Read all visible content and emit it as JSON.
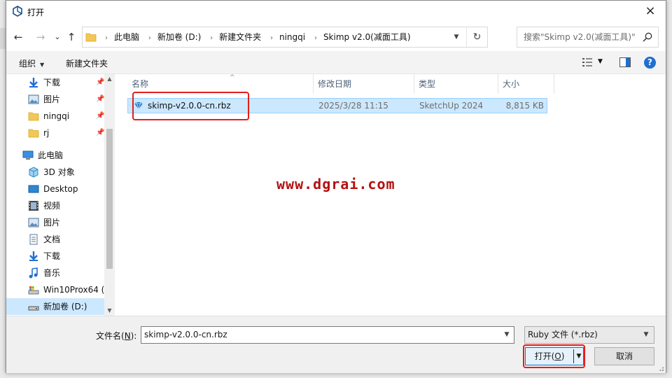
{
  "window": {
    "title": "打开",
    "close_icon": "×"
  },
  "nav": {
    "back_icon": "←",
    "forward_icon": "→",
    "recent_icon": "⌄",
    "up_icon": "↑",
    "breadcrumbs": [
      "此电脑",
      "新加卷 (D:)",
      "新建文件夹",
      "ningqi",
      "Skimp v2.0(减面工具)"
    ],
    "search_placeholder": "搜索\"Skimp v2.0(减面工具)\""
  },
  "toolbar": {
    "organize_label": "组织",
    "new_folder_label": "新建文件夹"
  },
  "sidebar": {
    "items": [
      {
        "label": "下载",
        "icon": "download-icon",
        "pinned": true
      },
      {
        "label": "图片",
        "icon": "pictures-icon",
        "pinned": true
      },
      {
        "label": "ningqi",
        "icon": "folder-icon",
        "pinned": true
      },
      {
        "label": "rj",
        "icon": "folder-icon",
        "pinned": true
      },
      {
        "label": "此电脑",
        "icon": "computer-icon",
        "pinned": false
      },
      {
        "label": "3D 对象",
        "icon": "3d-objects-icon",
        "pinned": false
      },
      {
        "label": "Desktop",
        "icon": "desktop-icon",
        "pinned": false
      },
      {
        "label": "视频",
        "icon": "videos-icon",
        "pinned": false
      },
      {
        "label": "图片",
        "icon": "pictures-icon",
        "pinned": false
      },
      {
        "label": "文档",
        "icon": "documents-icon",
        "pinned": false
      },
      {
        "label": "下载",
        "icon": "download-icon",
        "pinned": false
      },
      {
        "label": "音乐",
        "icon": "music-icon",
        "pinned": false
      },
      {
        "label": "Win10Prox64 (C",
        "icon": "system-drive-icon",
        "pinned": false
      },
      {
        "label": "新加卷 (D:)",
        "icon": "drive-icon",
        "pinned": false,
        "selected": true
      }
    ]
  },
  "files": {
    "columns": [
      "名称",
      "修改日期",
      "类型",
      "大小"
    ],
    "rows": [
      {
        "name": "skimp-v2.0.0-cn.rbz",
        "modified": "2025/3/28 11:15",
        "type": "SketchUp 2024",
        "size": "8,815 KB"
      }
    ]
  },
  "watermark": "www.dgrai.com",
  "footer": {
    "filename_label": "文件名(N):",
    "filename_label_main": "文件名(",
    "filename_label_key": "N",
    "filename_label_end": "):",
    "filename_value": "skimp-v2.0.0-cn.rbz",
    "filetype_value": "Ruby 文件 (*.rbz)",
    "open_label": "打开(O)",
    "open_label_main": "打开(",
    "open_label_key": "O",
    "open_label_end": ")",
    "cancel_label": "取消"
  },
  "colors": {
    "accent": "#0078d7",
    "selection": "#cce8ff",
    "highlight_box": "#e41e1e",
    "watermark": "#b50f0f"
  }
}
